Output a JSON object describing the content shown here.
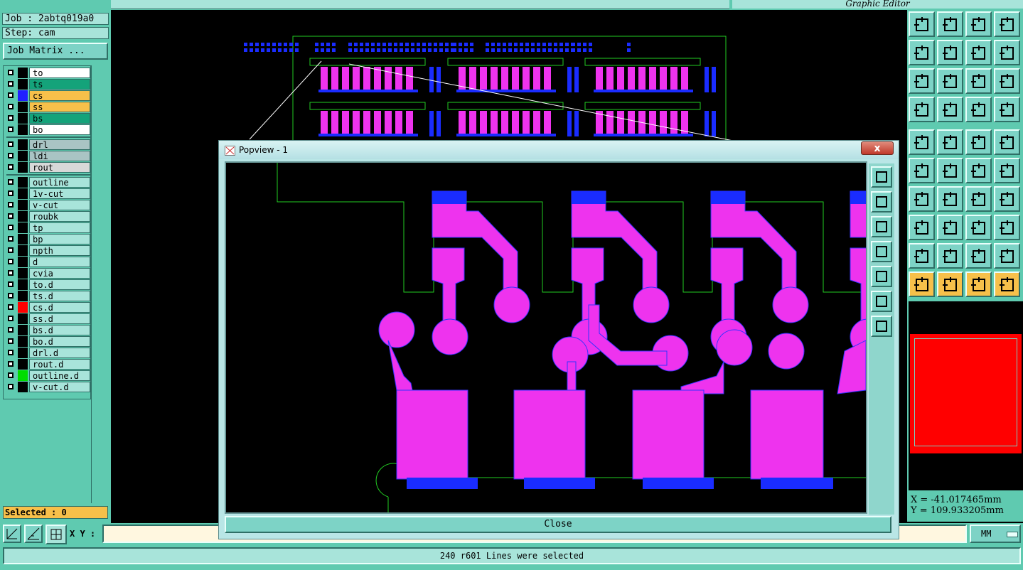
{
  "job": {
    "job_label": "Job : 2abtq019a0",
    "step_label": "Step: cam",
    "matrix_button": "Job Matrix ..."
  },
  "title_partial": "Graphic Editor",
  "layers": [
    {
      "name": "to",
      "color": "#ffffff",
      "swatch": "#000000"
    },
    {
      "name": "ts",
      "color": "#14a37a",
      "swatch": "#000000"
    },
    {
      "name": "cs",
      "color": "#f7c04a",
      "swatch": "#2020ff",
      "active": true
    },
    {
      "name": "ss",
      "color": "#f7c04a",
      "swatch": "#000000"
    },
    {
      "name": "bs",
      "color": "#14a37a",
      "swatch": "#000000"
    },
    {
      "name": "bo",
      "color": "#ffffff",
      "swatch": "#000000"
    },
    {
      "name": "drl",
      "color": "#a9c4c4",
      "swatch": "#000000"
    },
    {
      "name": "ldi",
      "color": "#a9c4c4",
      "swatch": "#000000"
    },
    {
      "name": "rout",
      "color": "#d8d8d8",
      "swatch": "#000000"
    },
    {
      "name": "outline",
      "color": "#a8e4da",
      "swatch": "#000000"
    },
    {
      "name": "1v-cut",
      "color": "#a8e4da",
      "swatch": "#000000"
    },
    {
      "name": "v-cut",
      "color": "#a8e4da",
      "swatch": "#000000"
    },
    {
      "name": "roubk",
      "color": "#a8e4da",
      "swatch": "#000000"
    },
    {
      "name": "tp",
      "color": "#a8e4da",
      "swatch": "#000000"
    },
    {
      "name": "bp",
      "color": "#a8e4da",
      "swatch": "#000000"
    },
    {
      "name": "npth",
      "color": "#a8e4da",
      "swatch": "#000000"
    },
    {
      "name": "d",
      "color": "#a8e4da",
      "swatch": "#000000"
    },
    {
      "name": "cvia",
      "color": "#a8e4da",
      "swatch": "#000000"
    },
    {
      "name": "to.d",
      "color": "#a8e4da",
      "swatch": "#000000"
    },
    {
      "name": "ts.d",
      "color": "#a8e4da",
      "swatch": "#000000"
    },
    {
      "name": "cs.d",
      "color": "#a8e4da",
      "swatch": "#ff0000"
    },
    {
      "name": "ss.d",
      "color": "#a8e4da",
      "swatch": "#000000"
    },
    {
      "name": "bs.d",
      "color": "#a8e4da",
      "swatch": "#000000"
    },
    {
      "name": "bo.d",
      "color": "#a8e4da",
      "swatch": "#000000"
    },
    {
      "name": "drl.d",
      "color": "#a8e4da",
      "swatch": "#000000"
    },
    {
      "name": "rout.d",
      "color": "#a8e4da",
      "swatch": "#000000"
    },
    {
      "name": "outline.d",
      "color": "#a8e4da",
      "swatch": "#00dd00"
    },
    {
      "name": "v-cut.d",
      "color": "#a8e4da",
      "swatch": "#000000"
    }
  ],
  "selected_label": "Selected : 0",
  "xy_label": "X Y :",
  "xy_value": "",
  "units": "MM",
  "status": "240 r601 Lines were selected",
  "coords": {
    "x": "X = -41.017465mm",
    "y": "Y = 109.933205mm"
  },
  "popview": {
    "title": "Popview - 1",
    "close_label": "Close",
    "close_x": "x"
  },
  "colors": {
    "copper": "#ee33ee",
    "pad": "#1a2cff",
    "outline": "#22cc22",
    "panel": "#5fcab0"
  }
}
